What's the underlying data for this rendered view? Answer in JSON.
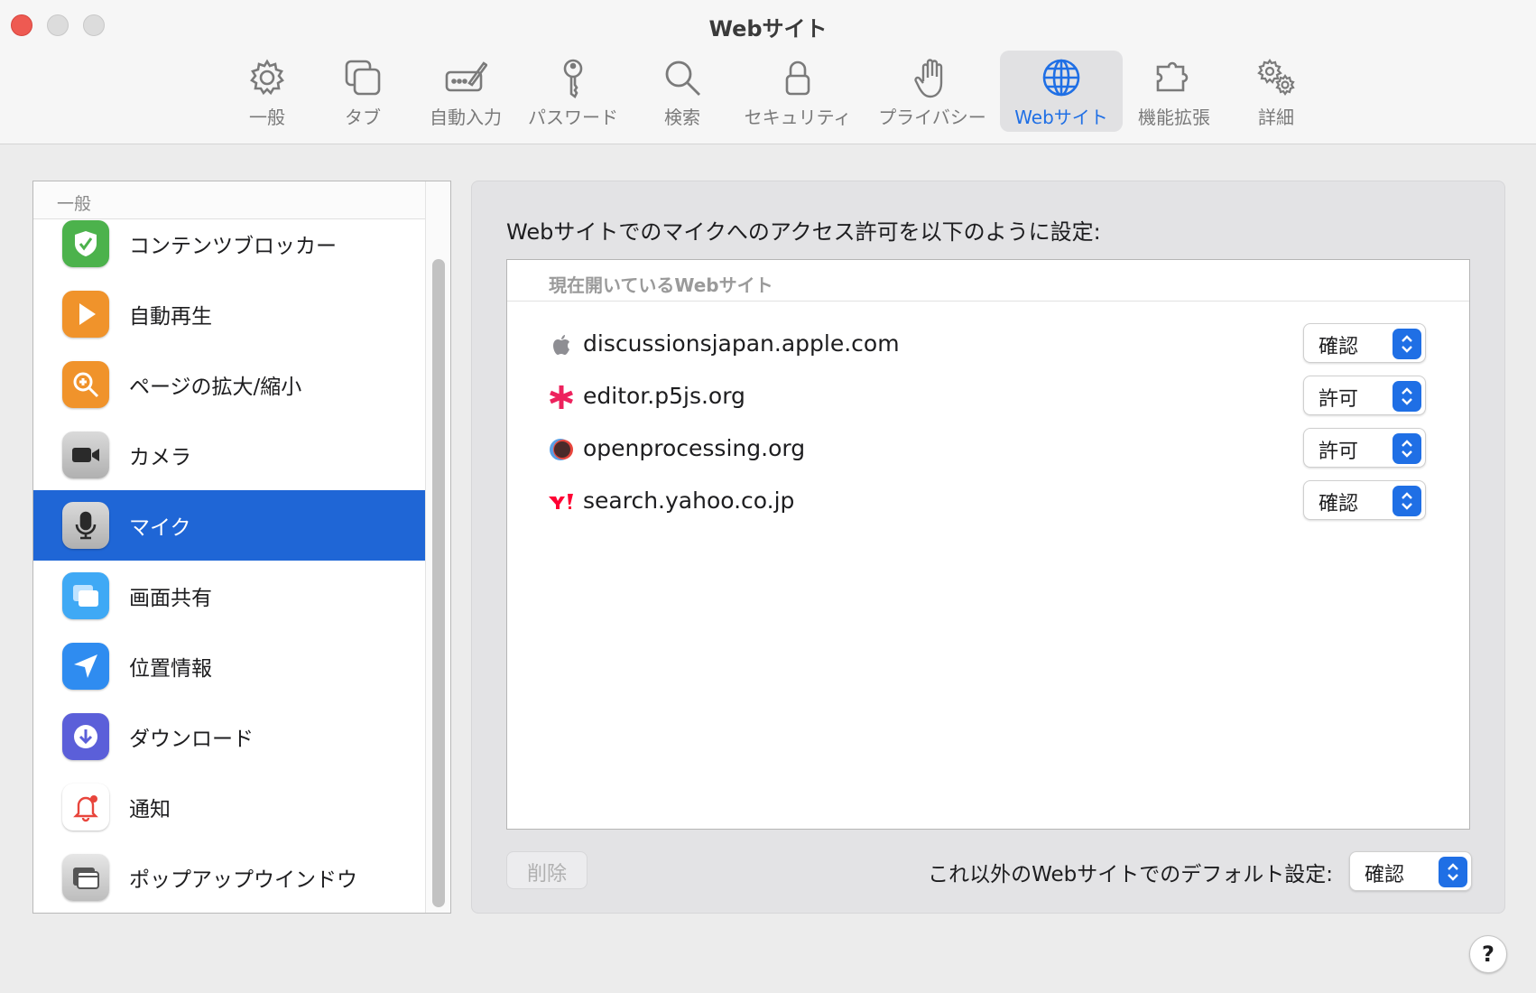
{
  "window": {
    "title": "Webサイト"
  },
  "toolbar": {
    "tabs": [
      {
        "label": "一般",
        "icon": "gear-icon"
      },
      {
        "label": "タブ",
        "icon": "tabs-icon"
      },
      {
        "label": "自動入力",
        "icon": "autofill-icon"
      },
      {
        "label": "パスワード",
        "icon": "key-icon"
      },
      {
        "label": "検索",
        "icon": "search-icon"
      },
      {
        "label": "セキュリティ",
        "icon": "lock-icon"
      },
      {
        "label": "プライバシー",
        "icon": "hand-icon"
      },
      {
        "label": "Webサイト",
        "icon": "globe-icon",
        "active": true
      },
      {
        "label": "機能拡張",
        "icon": "puzzle-icon"
      },
      {
        "label": "詳細",
        "icon": "gears-icon"
      }
    ]
  },
  "sidebar": {
    "section_header": "一般",
    "items": [
      {
        "label": "コンテンツブロッカー",
        "icon": "shield-check-icon",
        "color": "#4cb24c"
      },
      {
        "label": "自動再生",
        "icon": "play-icon",
        "color": "#f0932b"
      },
      {
        "label": "ページの拡大/縮小",
        "icon": "zoom-icon",
        "color": "#f0932b"
      },
      {
        "label": "カメラ",
        "icon": "video-camera-icon",
        "color": "#8e8e93"
      },
      {
        "label": "マイク",
        "icon": "microphone-icon",
        "color": "#8e8e93",
        "selected": true
      },
      {
        "label": "画面共有",
        "icon": "screen-share-icon",
        "color": "#3fa9f5"
      },
      {
        "label": "位置情報",
        "icon": "location-arrow-icon",
        "color": "#2f8cf0"
      },
      {
        "label": "ダウンロード",
        "icon": "download-icon",
        "color": "#5b5fd9"
      },
      {
        "label": "通知",
        "icon": "bell-icon",
        "color": "#ffffff"
      },
      {
        "label": "ポップアップウインドウ",
        "icon": "popup-window-icon",
        "color": "#9a9a9a"
      }
    ]
  },
  "main": {
    "heading": "Webサイトでのマイクへのアクセス許可を以下のように設定:",
    "site_list_header": "現在開いているWebサイト",
    "sites": [
      {
        "name": "discussionsjapan.apple.com",
        "icon": "apple-icon",
        "setting": "確認"
      },
      {
        "name": "editor.p5js.org",
        "icon": "p5js-asterisk-icon",
        "setting": "許可"
      },
      {
        "name": "openprocessing.org",
        "icon": "openprocessing-icon",
        "setting": "許可"
      },
      {
        "name": "search.yahoo.co.jp",
        "icon": "yahoo-icon",
        "setting": "確認"
      }
    ],
    "delete_label": "削除",
    "default_label": "これ以外のWebサイトでのデフォルト設定:",
    "default_value": "確認"
  },
  "help": {
    "label": "?"
  },
  "colors": {
    "accent": "#1f6fe5",
    "selection": "#1f66d6"
  }
}
